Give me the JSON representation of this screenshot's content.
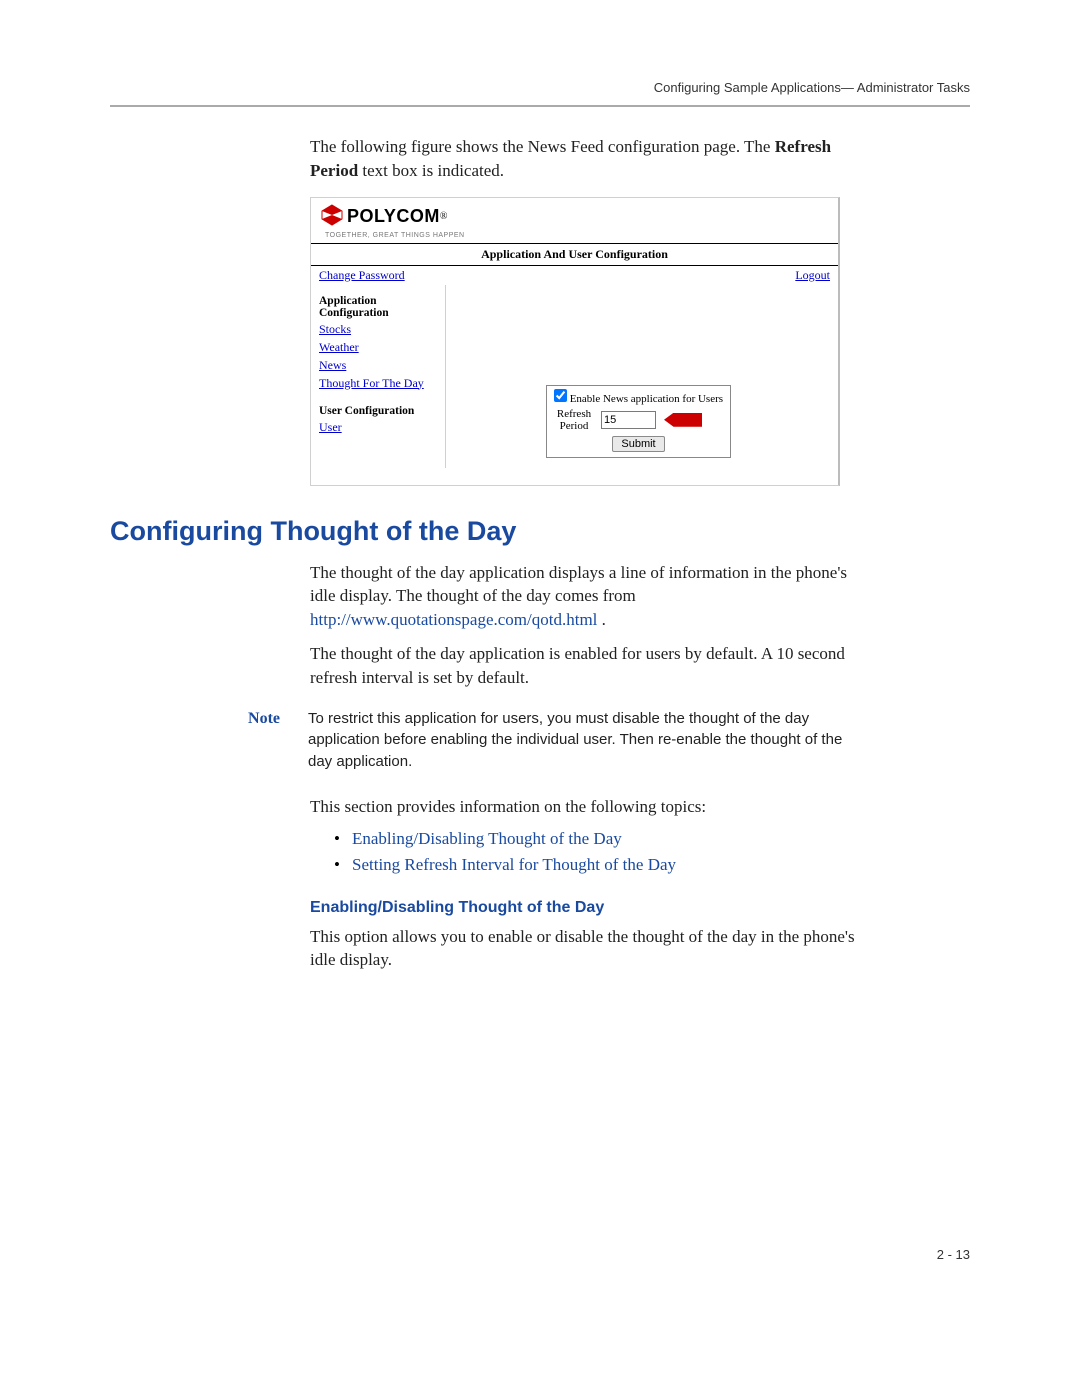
{
  "header": {
    "running_head": "Configuring Sample Applications— Administrator Tasks"
  },
  "intro": {
    "p1_a": "The following figure shows the News Feed configuration page. The ",
    "p1_bold1": "Refresh Period",
    "p1_b": " text box is indicated."
  },
  "figure": {
    "logo_text": "POLYCOM",
    "tagline": "TOGETHER, GREAT THINGS HAPPEN",
    "title": "Application And User Configuration",
    "change_password": "Change Password",
    "logout": "Logout",
    "left": {
      "app_cfg_heading": "Application Configuration",
      "items_app": [
        "Stocks",
        "Weather",
        "News",
        "Thought For The Day"
      ],
      "user_cfg_heading": "User Configuration",
      "items_user": [
        "User"
      ]
    },
    "box": {
      "enable_label": "Enable News application for Users",
      "refresh_label": "Refresh Period",
      "refresh_value": "15",
      "submit": "Submit"
    }
  },
  "section": {
    "heading": "Configuring Thought of the Day",
    "p1_a": "The thought of the day application displays a line of information in the phone's idle display. The thought of the day comes from ",
    "p1_link": "http://www.quotationspage.com/qotd.html",
    "p1_b": " .",
    "p2": "The thought of the day application is enabled for users by default. A 10 second refresh interval is set by default.",
    "note_label": "Note",
    "note_text": "To restrict this application for users, you must disable the thought of the day application before enabling the individual user. Then re-enable the thought of the day application.",
    "p3": "This section provides information on the following topics:",
    "topics": [
      "Enabling/Disabling Thought of the Day",
      "Setting Refresh Interval for Thought of the Day"
    ],
    "sub_heading": "Enabling/Disabling Thought of the Day",
    "sub_p1": "This option allows you to enable or disable the thought of the day in the phone's idle display."
  },
  "footer": {
    "page_number": "2 - 13"
  }
}
